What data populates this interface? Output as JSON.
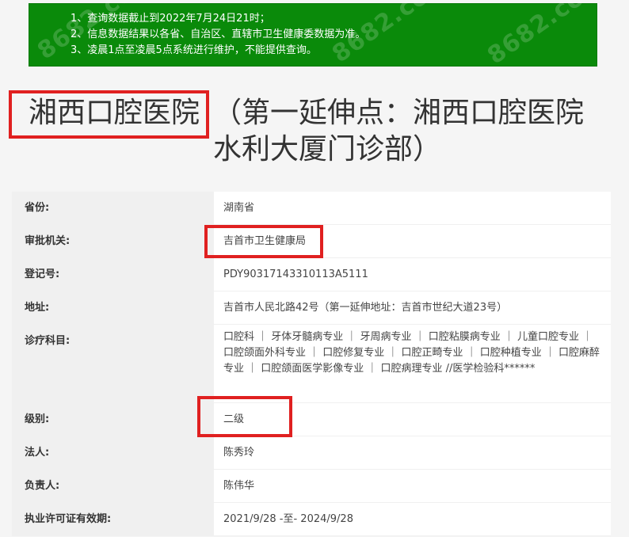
{
  "notice": {
    "lines": [
      "1、查询数据截止到2022年7月24日21时；",
      "2、信息数据结果以各省、自治区、直辖市卫生健康委数据为准。",
      "3、凌晨1点至凌晨5点系统进行维护，不能提供查询。"
    ],
    "watermark": "8682.cc",
    "bg_color": "#0a8a0a"
  },
  "title": {
    "name": "湘西口腔医院",
    "rest": "（第一延伸点：湘西口腔医院水利大厦门诊部）"
  },
  "rows": [
    {
      "label": "省份:",
      "value": "湖南省"
    },
    {
      "label": "审批机关:",
      "value": "吉首市卫生健康局"
    },
    {
      "label": "登记号:",
      "value": "PDY90317143310113A5111"
    },
    {
      "label": "地址:",
      "value": "吉首市人民北路42号（第一延伸地址：吉首市世纪大道23号）"
    },
    {
      "label": "诊疗科目:",
      "value": "口腔科 ｜ 牙体牙髓病专业 ｜ 牙周病专业 ｜ 口腔粘膜病专业 ｜ 儿童口腔专业 ｜ 口腔颌面外科专业 ｜ 口腔修复专业 ｜ 口腔正畸专业 ｜ 口腔种植专业 ｜ 口腔麻醉专业 ｜ 口腔颌面医学影像专业 ｜ 口腔病理专业 //医学检验科******"
    },
    {
      "label": "级别:",
      "value": "二级"
    },
    {
      "label": "法人:",
      "value": "陈秀玲"
    },
    {
      "label": "负责人:",
      "value": "陈伟华"
    },
    {
      "label": "执业许可证有效期:",
      "value": "2021/9/28 -至- 2024/9/28"
    }
  ],
  "highlight_color": "#e02020"
}
